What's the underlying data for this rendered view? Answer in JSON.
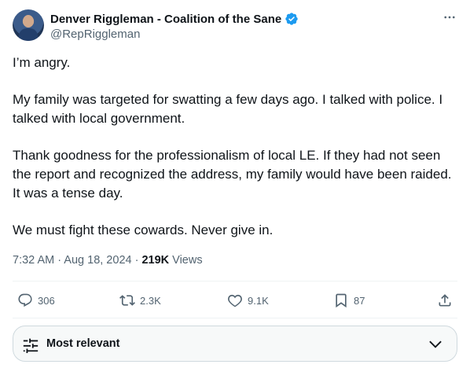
{
  "author": {
    "display_name": "Denver Riggleman - Coalition of the Sane",
    "handle": "@RepRiggleman",
    "verified": true,
    "verified_color": "#1d9bf0"
  },
  "tweet": {
    "paragraphs": [
      "I’m angry.",
      "My family was targeted for swatting a few days ago. I talked with police. I talked with local government.",
      "Thank goodness for the professionalism of local LE. If they had not seen the report and recognized the address, my family would have been raided. It was a tense day.",
      "We must fight these cowards. Never give in."
    ],
    "time": "7:32 AM",
    "separator": " · ",
    "date": "Aug 18, 2024",
    "views_count": "219K",
    "views_label": " Views"
  },
  "actions": {
    "reply": {
      "icon": "reply-icon",
      "count": "306"
    },
    "repost": {
      "icon": "repost-icon",
      "count": "2.3K"
    },
    "like": {
      "icon": "like-icon",
      "count": "9.1K"
    },
    "bookmark": {
      "icon": "bookmark-icon",
      "count": "87"
    },
    "share": {
      "icon": "share-icon"
    }
  },
  "sort": {
    "icon": "sliders-icon",
    "label": "Most relevant",
    "chevron": "chevron-down-icon"
  },
  "colors": {
    "text_primary": "#0f1419",
    "text_secondary": "#536471",
    "divider": "#eff3f4",
    "accent": "#1d9bf0"
  }
}
